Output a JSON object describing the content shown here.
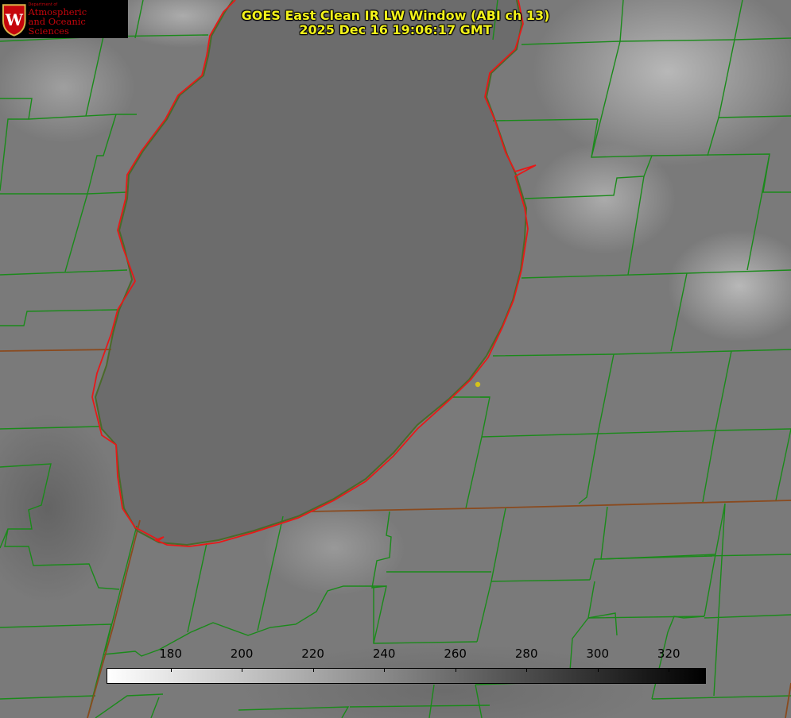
{
  "title": {
    "line1": "GOES East Clean IR LW Window (ABI ch 13)",
    "line2": "2025 Dec 16 19:06:17 GMT"
  },
  "logo": {
    "small_text": "Department of",
    "line1": "Atmospheric",
    "line2": "and Oceanic Sciences",
    "crest_letter": "W"
  },
  "colorbar": {
    "min_value": 162,
    "max_value": 330,
    "ticks": [
      "180",
      "200",
      "220",
      "240",
      "260",
      "280",
      "300",
      "320"
    ],
    "gradient_from": "#ffffff",
    "gradient_to": "#000000"
  },
  "colors": {
    "county_lines": "#1a8a1a",
    "coastline": "#e81818",
    "background_gray": "#7a7a7a",
    "title_text": "#f2f21a",
    "point_marker": "#d4c21a"
  },
  "map": {
    "feature": "Lake Michigan (southern basin)",
    "imagery": "grayscale infrared"
  }
}
